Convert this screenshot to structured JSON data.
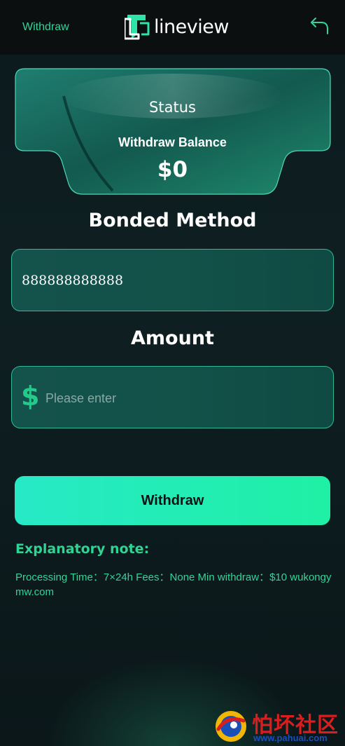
{
  "header": {
    "title": "Withdraw",
    "brand_name": "lineview",
    "back_icon": "back-arrow-icon"
  },
  "status_card": {
    "title": "Status",
    "balance_label": "Withdraw Balance",
    "balance_value": "$0"
  },
  "bonded": {
    "heading": "Bonded Method",
    "value": "888888888888"
  },
  "amount": {
    "heading": "Amount",
    "currency_symbol": "$",
    "placeholder": "Please enter"
  },
  "actions": {
    "withdraw_label": "Withdraw"
  },
  "note": {
    "title": "Explanatory note:",
    "text": "Processing Time：7×24h Fees：None Min withdraw：$10 wukongymw.com"
  },
  "watermark": {
    "name_cn": "怕坏社区",
    "url": "www.pahuai.com"
  },
  "colors": {
    "accent": "#34d39a",
    "button_start": "#27e9c6",
    "button_end": "#1ff0a5",
    "field_border": "#2fb995",
    "background": "#0e1f22"
  }
}
